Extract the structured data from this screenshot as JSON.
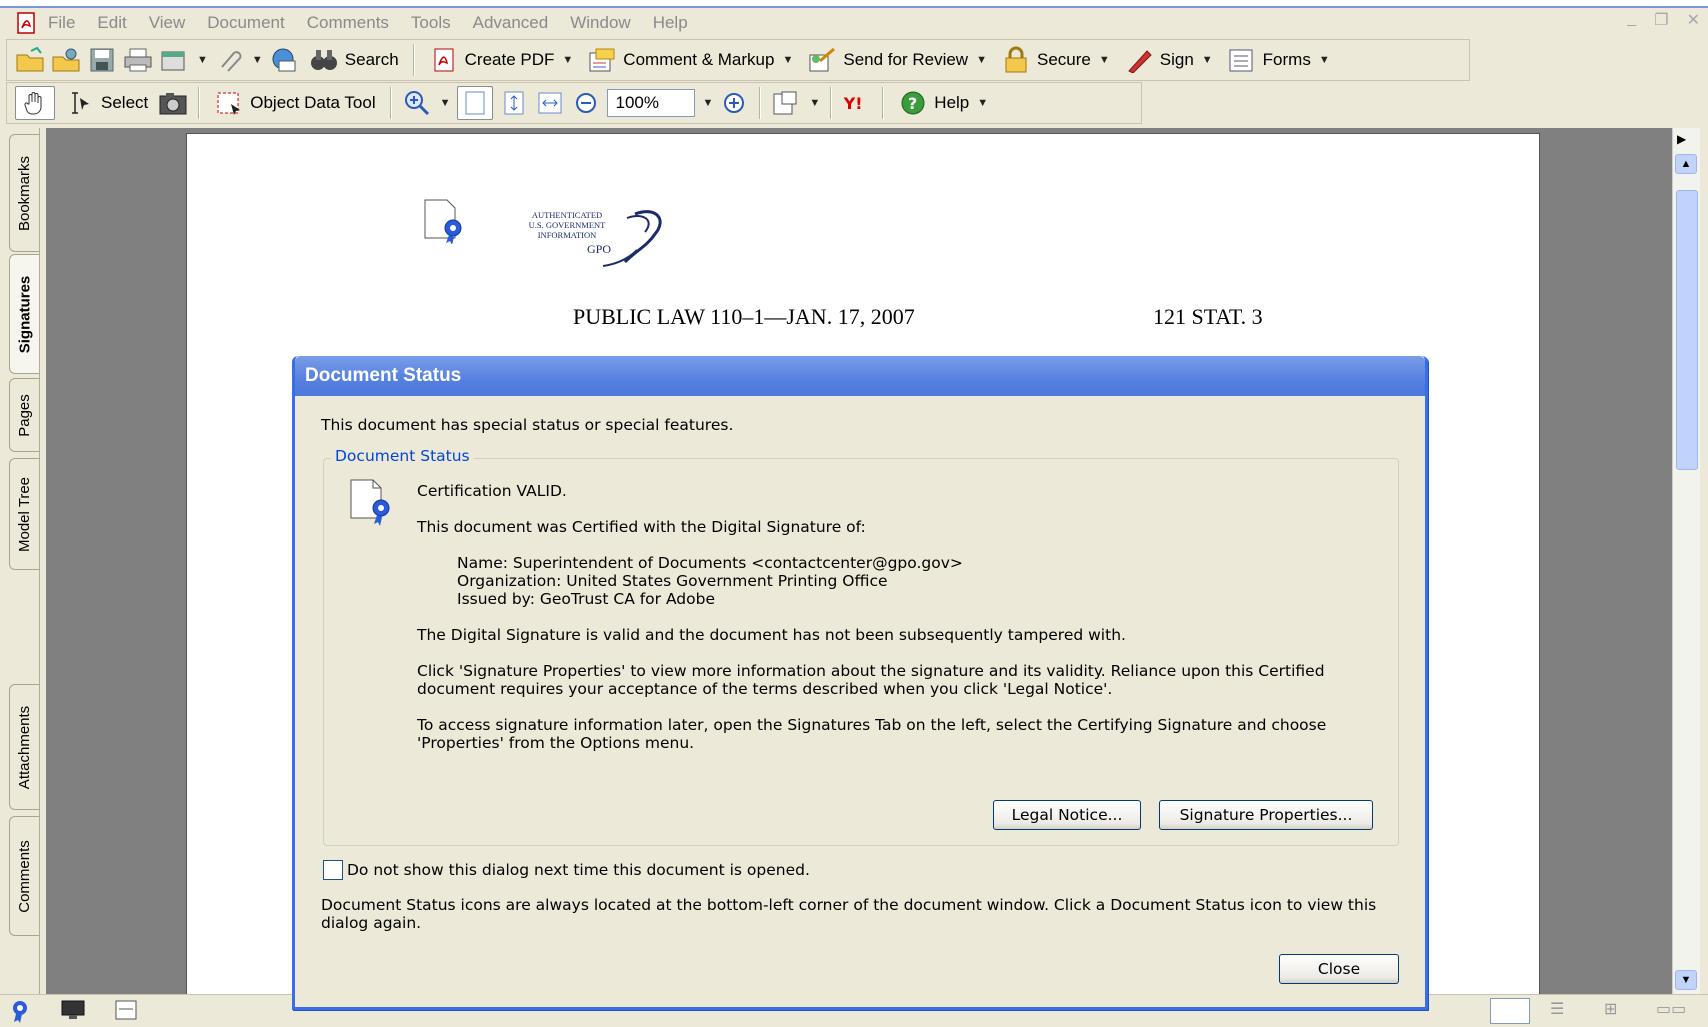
{
  "menu": {
    "items": [
      "File",
      "Edit",
      "View",
      "Document",
      "Comments",
      "Tools",
      "Advanced",
      "Window",
      "Help"
    ]
  },
  "toolbar1": {
    "search": "Search",
    "create_pdf": "Create PDF",
    "comment_markup": "Comment & Markup",
    "send_review": "Send for Review",
    "secure": "Secure",
    "sign": "Sign",
    "forms": "Forms"
  },
  "toolbar2": {
    "select": "Select",
    "object_data_tool": "Object Data Tool",
    "zoom": "100%",
    "help": "Help"
  },
  "left_tabs": [
    "Bookmarks",
    "Signatures",
    "Pages",
    "Model Tree",
    "Attachments",
    "Comments"
  ],
  "document": {
    "seal_text": [
      "AUTHENTICATED",
      "U.S. GOVERNMENT",
      "INFORMATION"
    ],
    "seal_gpo": "GPO",
    "header_left": "PUBLIC LAW 110–1—JAN. 17, 2007",
    "header_right": "121 STAT. 3"
  },
  "dialog": {
    "title": "Document Status",
    "intro": "This document has special status or special features.",
    "group_label": "Document Status",
    "cert_valid": "Certification VALID.",
    "certified_by": "This document was Certified with the Digital Signature of:",
    "name": "Name: Superintendent of Documents <contactcenter@gpo.gov>",
    "organization": "Organization: United States Government Printing Office",
    "issued_by": "Issued by: GeoTrust CA for Adobe",
    "valid_text": "The Digital Signature is valid and the document has not been subsequently tampered with.",
    "click_text_1": "Click 'Signature Properties' to view more information about the signature and its validity. Reliance upon this Certified",
    "click_text_2": "document requires your acceptance of the terms described when you click 'Legal Notice'.",
    "access_text_1": "To access signature information later, open the Signatures Tab on the left, select the Certifying Signature and choose",
    "access_text_2": "'Properties' from the Options menu.",
    "legal_notice_button": "Legal Notice...",
    "sig_props_button": "Signature Properties...",
    "checkbox_label": "Do not show this dialog next time this document is opened.",
    "footer_1": "Document Status icons are always located at the bottom-left corner of the document window. Click a Document Status icon to view this",
    "footer_2": "dialog again.",
    "close_button": "Close"
  },
  "colors": {
    "titlebar": "#5580e0",
    "group_label": "#0046d5",
    "app_bg": "#ece9d8"
  }
}
